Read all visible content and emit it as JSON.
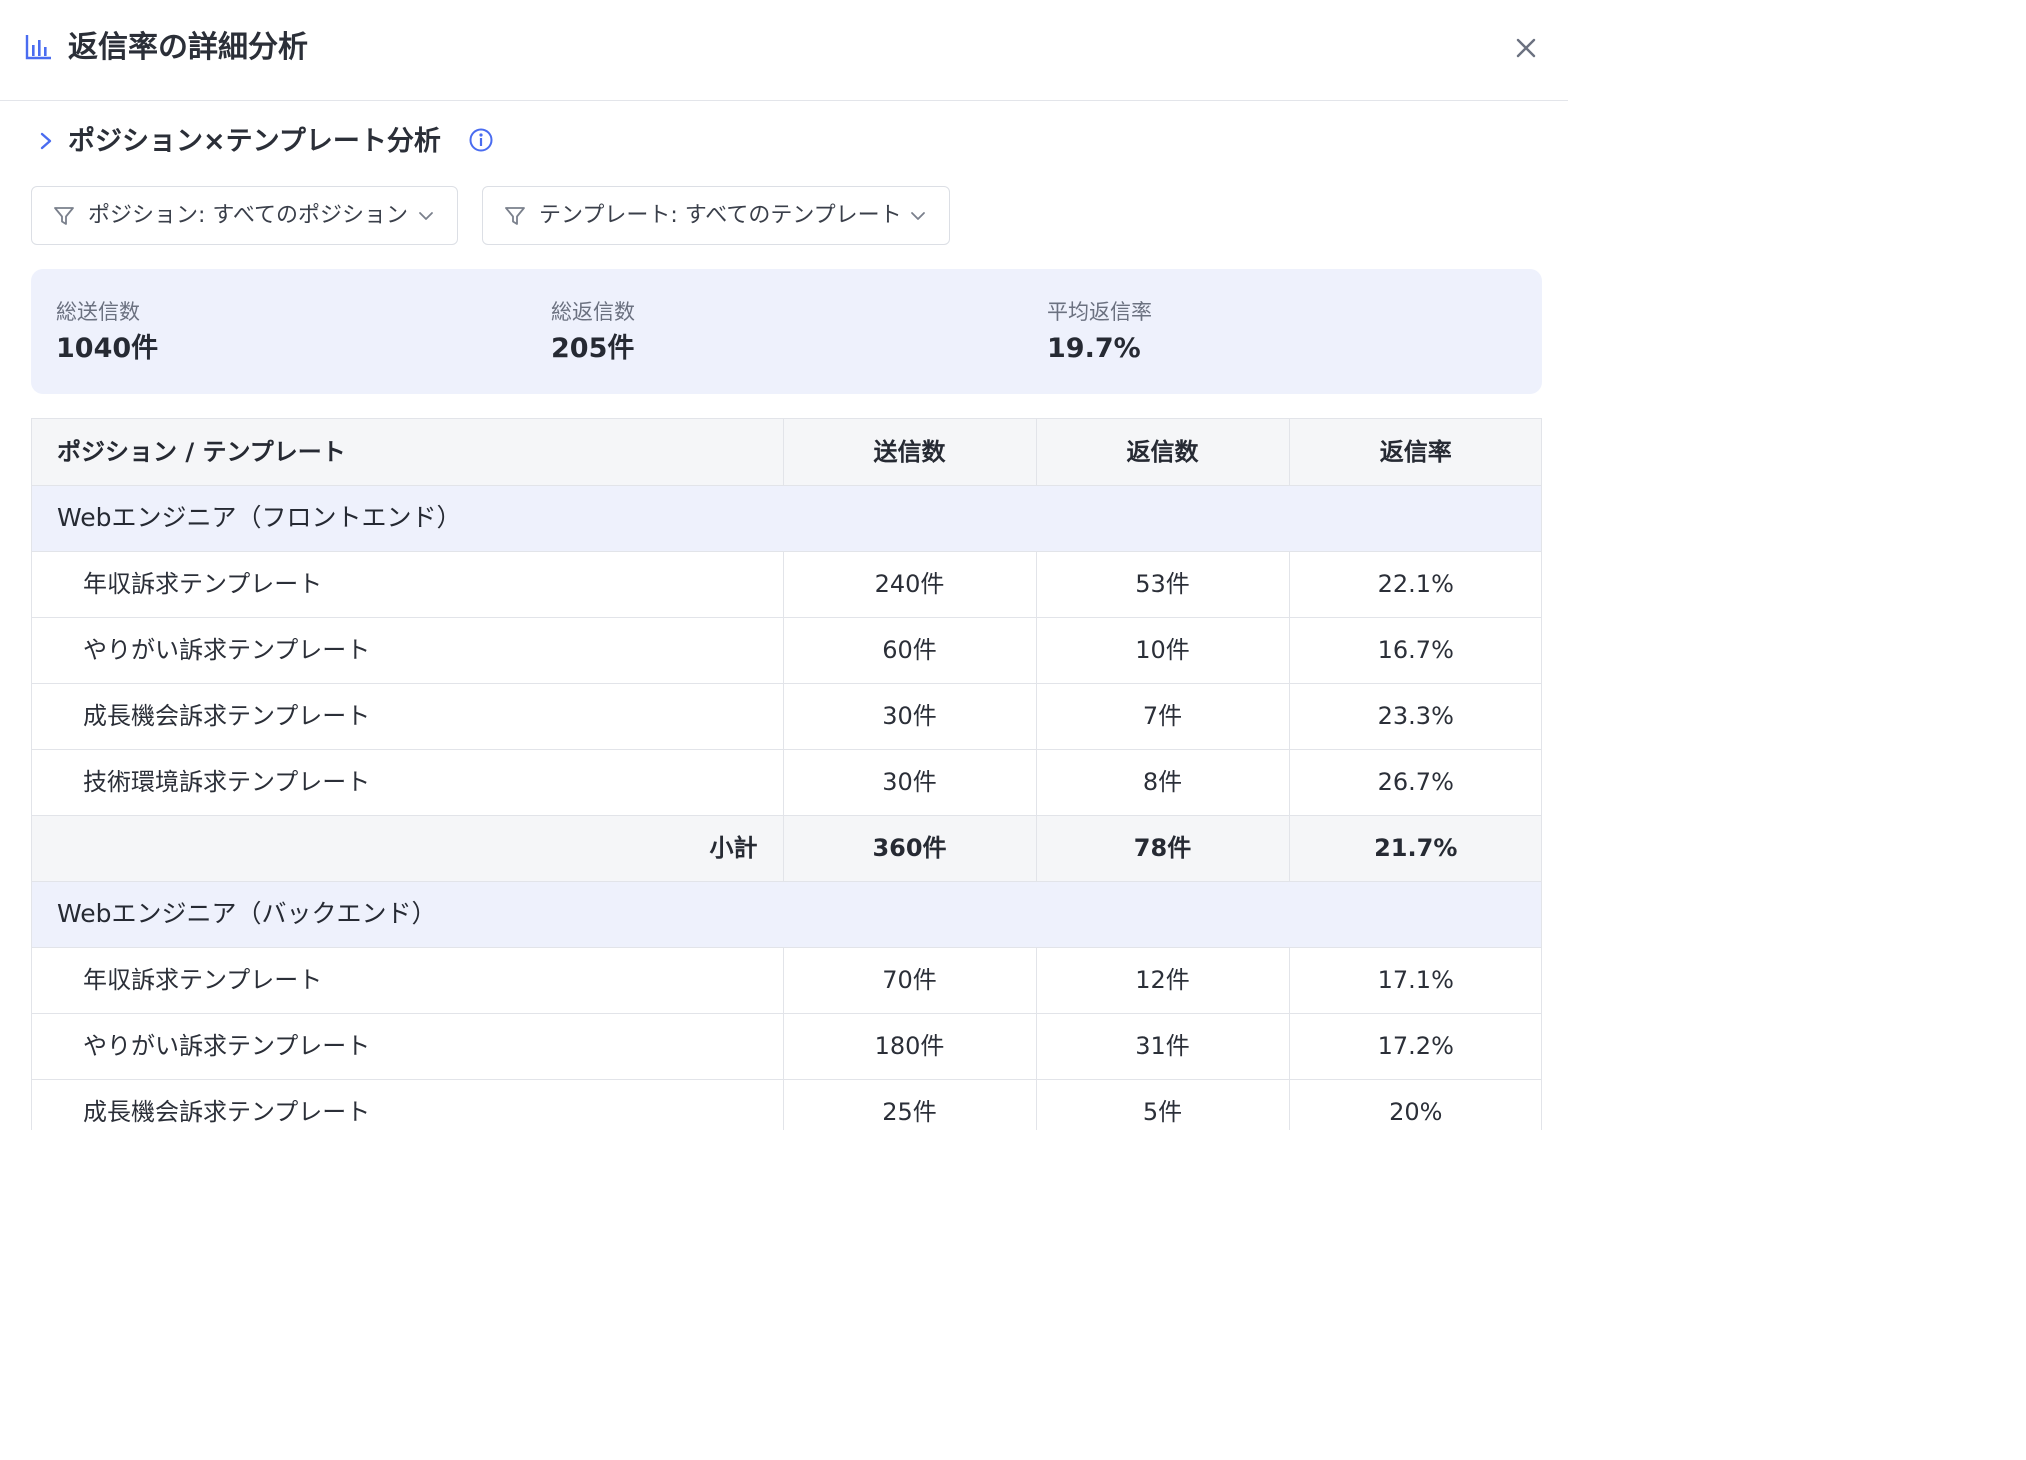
{
  "header": {
    "title": "返信率の詳細分析",
    "icon": "bar-chart-icon",
    "close_icon": "close-icon"
  },
  "section": {
    "title": "ポジション×テンプレート分析",
    "expand_icon": "chevron-right-icon",
    "info_icon": "info-icon"
  },
  "filters": {
    "position": {
      "label": "ポジション: すべてのポジション",
      "icon": "filter-icon"
    },
    "template": {
      "label": "テンプレート: すべてのテンプレート",
      "icon": "filter-icon"
    }
  },
  "summary": {
    "total_sent_label": "総送信数",
    "total_sent_value": "1040件",
    "total_replies_label": "総返信数",
    "total_replies_value": "205件",
    "avg_rate_label": "平均返信率",
    "avg_rate_value": "19.7%"
  },
  "table": {
    "headers": [
      "ポジション / テンプレート",
      "送信数",
      "返信数",
      "返信率"
    ],
    "groups": [
      {
        "name": "Webエンジニア（フロントエンド）",
        "rows": [
          [
            "年収訴求テンプレート",
            "240件",
            "53件",
            "22.1%"
          ],
          [
            "やりがい訴求テンプレート",
            "60件",
            "10件",
            "16.7%"
          ],
          [
            "成長機会訴求テンプレート",
            "30件",
            "7件",
            "23.3%"
          ],
          [
            "技術環境訴求テンプレート",
            "30件",
            "8件",
            "26.7%"
          ]
        ],
        "subtotal": [
          "小計",
          "360件",
          "78件",
          "21.7%"
        ]
      },
      {
        "name": "Webエンジニア（バックエンド）",
        "rows": [
          [
            "年収訴求テンプレート",
            "70件",
            "12件",
            "17.1%"
          ],
          [
            "やりがい訴求テンプレート",
            "180件",
            "31件",
            "17.2%"
          ],
          [
            "成長機会訴求テンプレート",
            "25件",
            "5件",
            "20%"
          ]
        ]
      }
    ]
  },
  "colors": {
    "accent": "#4a6cf0",
    "summary_bg": "#eef1fc",
    "group_row_bg": "#eef1fc",
    "header_bg": "#f5f6f8"
  }
}
